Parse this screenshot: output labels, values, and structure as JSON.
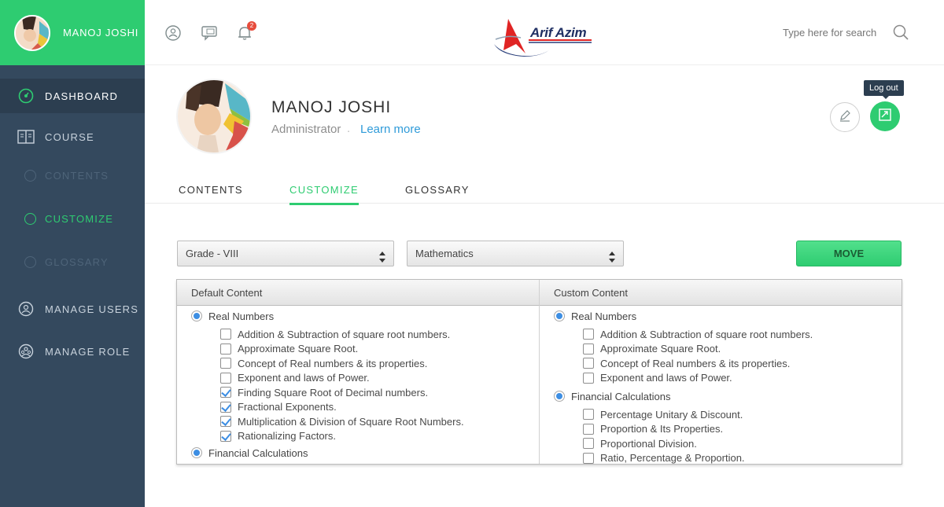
{
  "sidebar": {
    "user_name": "MANOJ JOSHI",
    "items": {
      "dashboard": "DASHBOARD",
      "course": "COURSE",
      "contents": "CONTENTS",
      "customize": "CUSTOMIZE",
      "glossary": "GLOSSARY",
      "manage_users": "MANAGE USERS",
      "manage_role": "MANAGE ROLE"
    }
  },
  "topbar": {
    "icons": [
      "user-circle-icon",
      "chat-icon",
      "bell-icon"
    ],
    "notification_count": "2",
    "logo_text": "Arif Azim",
    "search_placeholder": "Type here for search"
  },
  "profile": {
    "name": "MANOJ JOSHI",
    "role": "Administrator",
    "separator": ".",
    "learn_more": "Learn more",
    "logout_tooltip": "Log out"
  },
  "tabs": [
    "CONTENTS",
    "CUSTOMIZE",
    "GLOSSARY"
  ],
  "active_tab": "CUSTOMIZE",
  "filters": {
    "grade": "Grade - VIII",
    "subject": "Mathematics",
    "move_label": "MOVE"
  },
  "default_content": {
    "header": "Default Content",
    "groups": [
      {
        "title": "Real Numbers",
        "items": [
          {
            "label": "Addition & Subtraction of square root numbers.",
            "checked": false
          },
          {
            "label": "Approximate Square Root.",
            "checked": false
          },
          {
            "label": "Concept of Real numbers & its properties.",
            "checked": false
          },
          {
            "label": "Exponent and laws of Power.",
            "checked": false
          },
          {
            "label": "Finding Square Root of Decimal numbers.",
            "checked": true
          },
          {
            "label": "Fractional Exponents.",
            "checked": true
          },
          {
            "label": "Multiplication & Division of Square Root Numbers.",
            "checked": true
          },
          {
            "label": "Rationalizing Factors.",
            "checked": true
          }
        ]
      },
      {
        "title": "Financial Calculations",
        "items": []
      }
    ]
  },
  "custom_content": {
    "header": "Custom Content",
    "groups": [
      {
        "title": "Real Numbers",
        "items": [
          {
            "label": "Addition & Subtraction of square root numbers.",
            "checked": false
          },
          {
            "label": "Approximate Square Root.",
            "checked": false
          },
          {
            "label": "Concept of Real numbers & its properties.",
            "checked": false
          },
          {
            "label": "Exponent and laws of Power.",
            "checked": false
          }
        ]
      },
      {
        "title": "Financial Calculations",
        "items": [
          {
            "label": "Percentage Unitary & Discount.",
            "checked": false
          },
          {
            "label": "Proportion & Its Properties.",
            "checked": false
          },
          {
            "label": "Proportional Division.",
            "checked": false
          },
          {
            "label": "Ratio, Percentage & Proportion.",
            "checked": false
          }
        ]
      }
    ]
  },
  "colors": {
    "accent": "#2ecc71",
    "sidebar": "#34495e",
    "sidebar_active": "#2c3e50",
    "link": "#2f9bd9"
  }
}
